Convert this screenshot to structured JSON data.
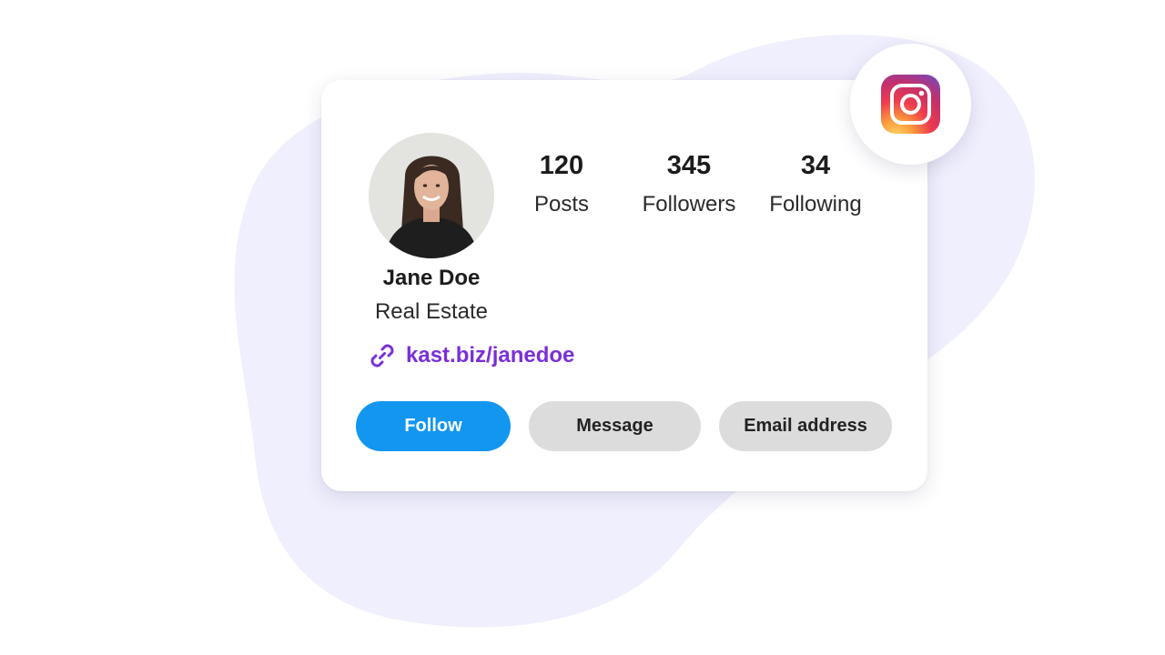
{
  "profile": {
    "name": "Jane Doe",
    "role": "Real Estate",
    "link": "kast.biz/janedoe",
    "avatar_icon": "profile-photo"
  },
  "stats": [
    {
      "value": "120",
      "label": "Posts"
    },
    {
      "value": "345",
      "label": "Followers"
    },
    {
      "value": "34",
      "label": "Following"
    }
  ],
  "actions": {
    "follow_label": "Follow",
    "message_label": "Message",
    "email_label": "Email address"
  },
  "icons": {
    "link": "link-icon",
    "brand": "instagram-icon"
  },
  "colors": {
    "background_blob": "#efeffd",
    "follow_button": "#1296f0",
    "secondary_button": "#dcdcdc",
    "link_accent": "#7a2fd8",
    "card": "#ffffff"
  }
}
